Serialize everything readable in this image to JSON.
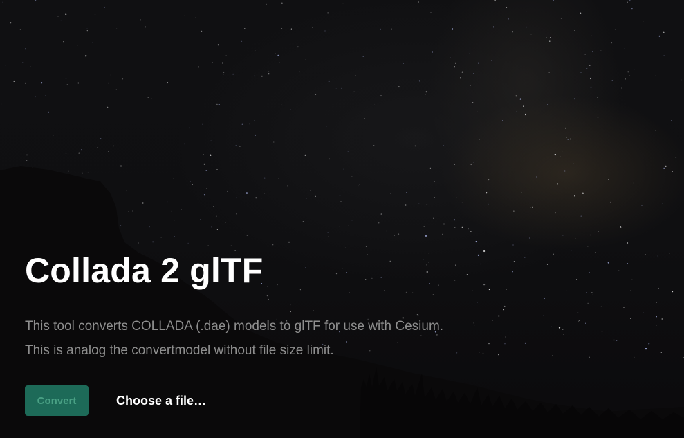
{
  "hero": {
    "title": "Collada 2 glTF",
    "description": {
      "line1": "This tool converts COLLADA (.dae) models to glTF for use with Cesium.",
      "line2_before": "This is analog the ",
      "line2_link": "convertmodel",
      "line2_after": " without file size limit."
    },
    "actions": {
      "convert_label": "Convert",
      "file_label": "Choose a file…"
    }
  },
  "colors": {
    "background": "#0b0a0b",
    "title": "#ffffff",
    "description": "#8e8e8e",
    "button_bg": "#1d6a58",
    "button_text": "#4aa185"
  },
  "background_image": {
    "subject": "night-sky-milky-way-with-tree-silhouettes"
  }
}
